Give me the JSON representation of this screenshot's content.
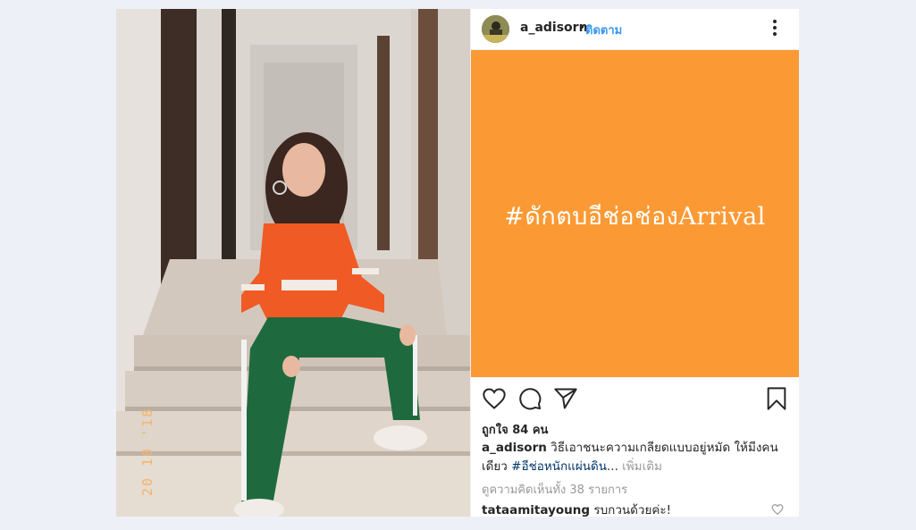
{
  "post": {
    "username": "a_adisorn",
    "separator": "•",
    "follow_label": "ติดตาม",
    "image_text": "#ดักตบอีช่อช่องArrival",
    "likes_text": "ถูกใจ 84 คน",
    "caption": {
      "username": "a_adisorn",
      "text": "วิธีเอาชนะความเกลียดแบบอยู่หมัด ให้มีงคนเดียว",
      "hashtag": "#อีช่อหนักแผ่นดิน",
      "ellipsis": "...",
      "more_label": "เพิ่มเติม"
    },
    "view_comments": "ดูความคิดเห็นทั้ง 38 รายการ",
    "comment": {
      "username": "tataamitayoung",
      "text": "รบกวนด้วยค่ะ!"
    }
  },
  "photo": {
    "date_stamp": "20 10 '18"
  },
  "icons": {
    "like": "heart-icon",
    "comment": "comment-icon",
    "share": "send-icon",
    "save": "bookmark-icon",
    "more": "more-icon"
  },
  "colors": {
    "post_background": "#fb9a34",
    "follow": "#3897f0",
    "hashtag": "#003569",
    "muted": "#999999"
  }
}
